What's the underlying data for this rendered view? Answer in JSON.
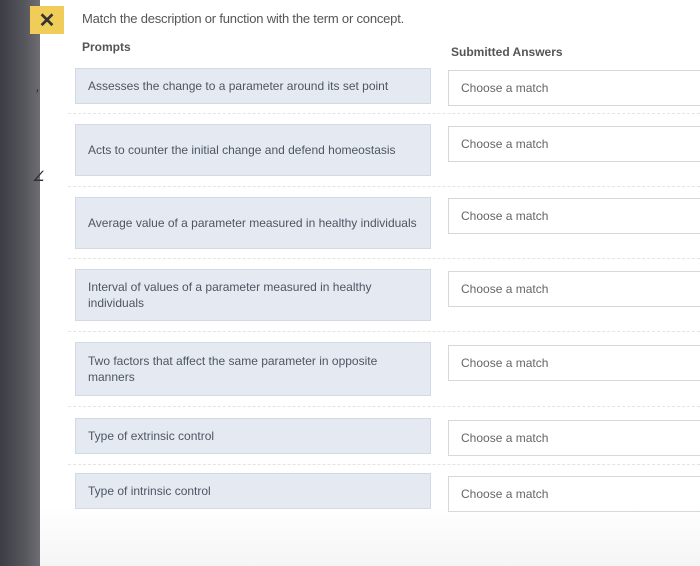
{
  "header": {
    "close_symbol": "✕",
    "instruction": "Match the description or function with the term or concept."
  },
  "columns": {
    "prompts": "Prompts",
    "answers": "Submitted Answers"
  },
  "rows": [
    {
      "prompt": "Assesses the change to a parameter around its set point",
      "answer": "Choose a match"
    },
    {
      "prompt": "Acts to counter the initial change and defend homeostasis",
      "answer": "Choose a match"
    },
    {
      "prompt": "Average value of a parameter measured in healthy individuals",
      "answer": "Choose a match"
    },
    {
      "prompt": "Interval of values of a parameter measured in healthy individuals",
      "answer": "Choose a match"
    },
    {
      "prompt": "Two factors that affect the same parameter in opposite manners",
      "answer": "Choose a match"
    },
    {
      "prompt": "Type of extrinsic control",
      "answer": "Choose a match"
    },
    {
      "prompt": "Type of intrinsic control",
      "answer": "Choose a match"
    }
  ],
  "icons": {
    "close": "close-icon"
  },
  "colors": {
    "close_button": "#f0cd58",
    "prompt_background": "#e5eaf2"
  }
}
